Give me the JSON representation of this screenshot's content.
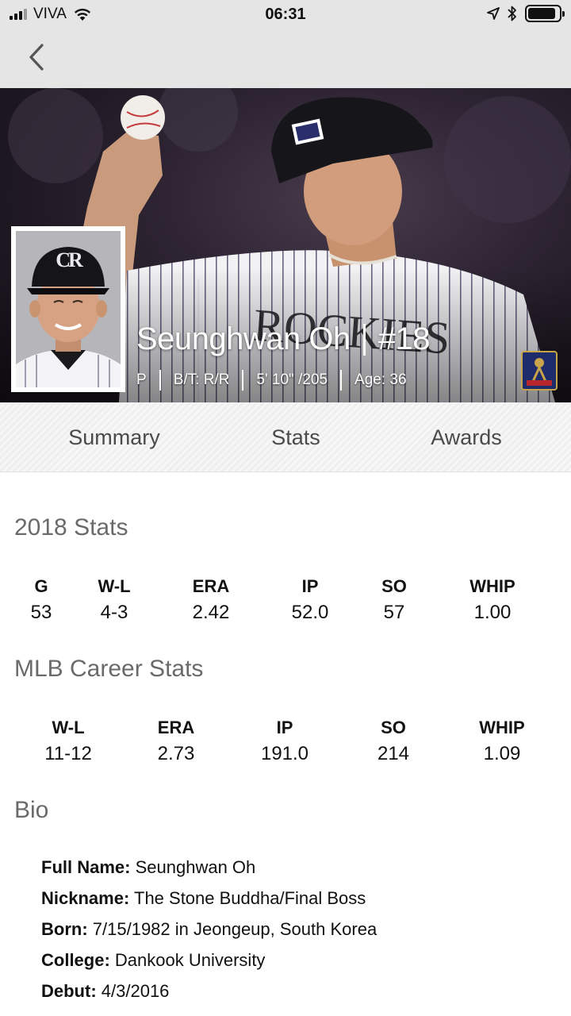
{
  "status_bar": {
    "carrier": "VIVA",
    "time": "06:31",
    "signal_bars": 3,
    "battery_level": 0.9
  },
  "nav": {
    "back_icon": "chevron-left-icon"
  },
  "player": {
    "name": "Seunghwan Oh",
    "number": "#18",
    "position": "P",
    "bats_throws": "B/T: R/R",
    "height_weight": "5' 10\" /205",
    "age": "Age: 36",
    "team_logo_text": "CR"
  },
  "tabs": [
    {
      "label": "Summary"
    },
    {
      "label": "Stats"
    },
    {
      "label": "Awards"
    }
  ],
  "season_stats": {
    "title": "2018 Stats",
    "columns": [
      {
        "label": "G",
        "value": "53"
      },
      {
        "label": "W-L",
        "value": "4-3"
      },
      {
        "label": "ERA",
        "value": "2.42"
      },
      {
        "label": "IP",
        "value": "52.0"
      },
      {
        "label": "SO",
        "value": "57"
      },
      {
        "label": "WHIP",
        "value": "1.00"
      }
    ]
  },
  "career_stats": {
    "title": "MLB Career Stats",
    "columns": [
      {
        "label": "W-L",
        "value": "11-12"
      },
      {
        "label": "ERA",
        "value": "2.73"
      },
      {
        "label": "IP",
        "value": "191.0"
      },
      {
        "label": "SO",
        "value": "214"
      },
      {
        "label": "WHIP",
        "value": "1.09"
      }
    ]
  },
  "bio": {
    "title": "Bio",
    "items": [
      {
        "label": "Full Name:",
        "value": "Seunghwan Oh"
      },
      {
        "label": "Nickname:",
        "value": "The Stone Buddha/Final Boss"
      },
      {
        "label": "Born:",
        "value": "7/15/1982 in Jeongeup, South Korea"
      },
      {
        "label": "College:",
        "value": "Dankook University"
      },
      {
        "label": "Debut:",
        "value": "4/3/2016"
      }
    ]
  }
}
